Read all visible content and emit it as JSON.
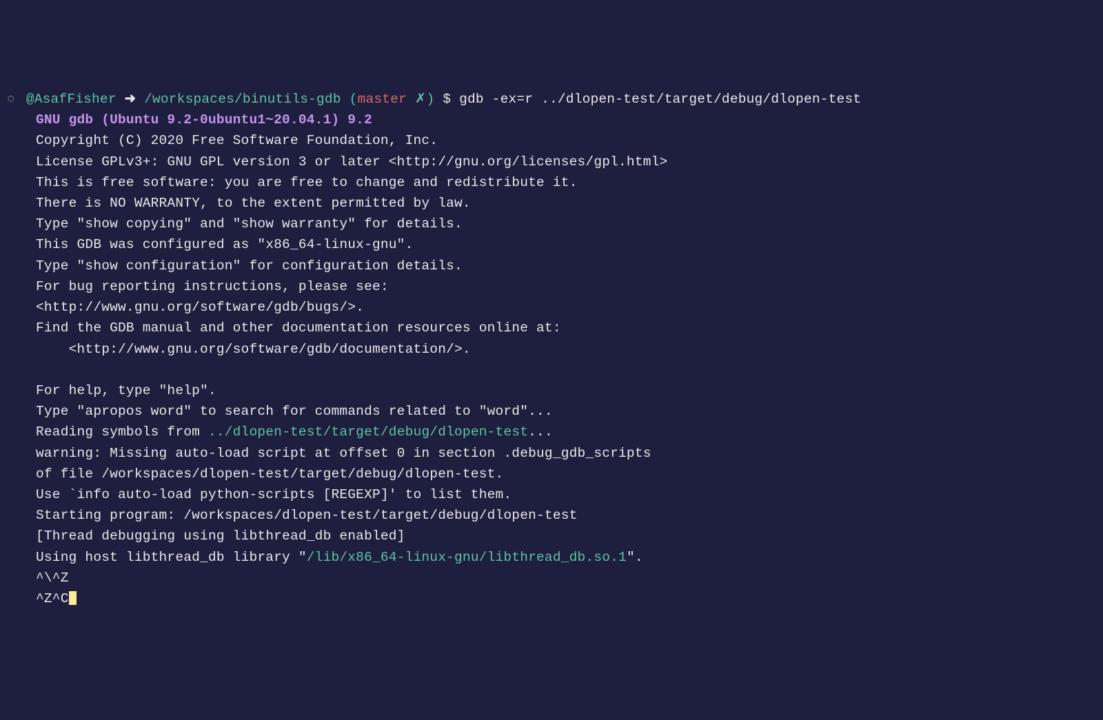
{
  "prompt": {
    "circle": "○",
    "user": "@AsafFisher",
    "arrow": "➜",
    "path": "/workspaces/binutils-gdb",
    "paren_open": "(",
    "branch": "master",
    "branch_x": "✗",
    "paren_close": ")",
    "dollar": "$",
    "command": "gdb -ex=r ../dlopen-test/target/debug/dlopen-test"
  },
  "version_line": "GNU gdb (Ubuntu 9.2-0ubuntu1~20.04.1) 9.2",
  "lines": {
    "copyright": "Copyright (C) 2020 Free Software Foundation, Inc.",
    "license": "License GPLv3+: GNU GPL version 3 or later <http://gnu.org/licenses/gpl.html>",
    "free_software": "This is free software: you are free to change and redistribute it.",
    "no_warranty": "There is NO WARRANTY, to the extent permitted by law.",
    "show_copying": "Type \"show copying\" and \"show warranty\" for details.",
    "configured": "This GDB was configured as \"x86_64-linux-gnu\".",
    "show_config": "Type \"show configuration\" for configuration details.",
    "bug_report": "For bug reporting instructions, please see:",
    "bugs_url": "<http://www.gnu.org/software/gdb/bugs/>.",
    "find_manual": "Find the GDB manual and other documentation resources online at:",
    "docs_url": "    <http://www.gnu.org/software/gdb/documentation/>.",
    "empty": "",
    "for_help": "For help, type \"help\".",
    "apropos": "Type \"apropos word\" to search for commands related to \"word\"...",
    "reading_prefix": "Reading symbols from ",
    "reading_path": "../dlopen-test/target/debug/dlopen-test",
    "reading_suffix": "...",
    "warning": "warning: Missing auto-load script at offset 0 in section .debug_gdb_scripts",
    "of_file": "of file /workspaces/dlopen-test/target/debug/dlopen-test.",
    "use_info": "Use `info auto-load python-scripts [REGEXP]' to list them.",
    "starting": "Starting program: /workspaces/dlopen-test/target/debug/dlopen-test",
    "thread_debug": "[Thread debugging using libthread_db enabled]",
    "using_host_prefix": "Using host libthread_db library \"",
    "using_host_path": "/lib/x86_64-linux-gnu/libthread_db.so.1",
    "using_host_suffix": "\".",
    "ctrl1": "^\\^Z",
    "ctrl2": "^Z^C"
  }
}
